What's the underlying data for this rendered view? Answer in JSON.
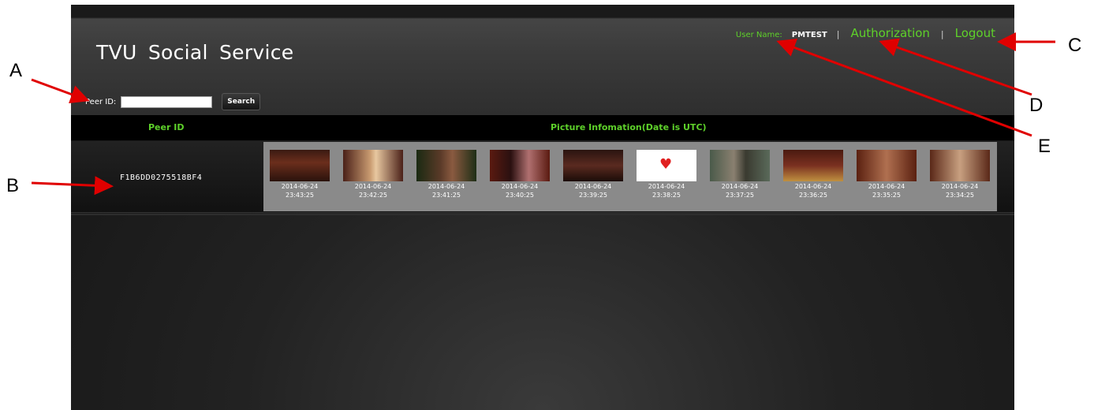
{
  "app": {
    "title": "TVU  Social  Service",
    "user_label": "User Name:",
    "user_name": "PMTEST",
    "separator": "|",
    "authorization_link": "Authorization",
    "logout_link": "Logout",
    "peer_label": "Peer ID:",
    "peer_input_value": "",
    "search_label": "Search",
    "accent_color": "#5ed12a"
  },
  "table": {
    "headers": {
      "peer": "Peer ID",
      "pictures": "Picture Infomation(Date is UTC)"
    },
    "row": {
      "peer_id": "F1B6DD0275518BF4",
      "pictures": [
        {
          "date": "2014-06-24",
          "time": "23:43:25"
        },
        {
          "date": "2014-06-24",
          "time": "23:42:25"
        },
        {
          "date": "2014-06-24",
          "time": "23:41:25"
        },
        {
          "date": "2014-06-24",
          "time": "23:40:25"
        },
        {
          "date": "2014-06-24",
          "time": "23:39:25"
        },
        {
          "date": "2014-06-24",
          "time": "23:38:25"
        },
        {
          "date": "2014-06-24",
          "time": "23:37:25"
        },
        {
          "date": "2014-06-24",
          "time": "23:36:25"
        },
        {
          "date": "2014-06-24",
          "time": "23:35:25"
        },
        {
          "date": "2014-06-24",
          "time": "23:34:25"
        }
      ]
    }
  },
  "callouts": [
    "A",
    "B",
    "C",
    "D",
    "E"
  ],
  "annotation_color": "#e00000"
}
